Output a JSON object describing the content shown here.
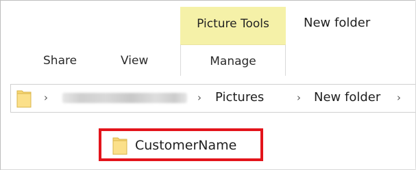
{
  "ribbon": {
    "contextual_group_label": "Picture Tools",
    "window_title": "New folder",
    "tabs": {
      "share": "Share",
      "view": "View",
      "manage": "Manage"
    },
    "contextual_color": "#f5f1a8"
  },
  "address_bar": {
    "chevron": "›",
    "crumbs": [
      "Pictures",
      "New folder"
    ],
    "blurred_crumb": "redacted"
  },
  "file_list": {
    "items": [
      {
        "name": "CustomerName",
        "icon": "folder-icon"
      }
    ],
    "highlight_color": "#e3141b"
  },
  "colors": {
    "folder_fill": "#f8d775",
    "folder_edge": "#d9b44a"
  }
}
